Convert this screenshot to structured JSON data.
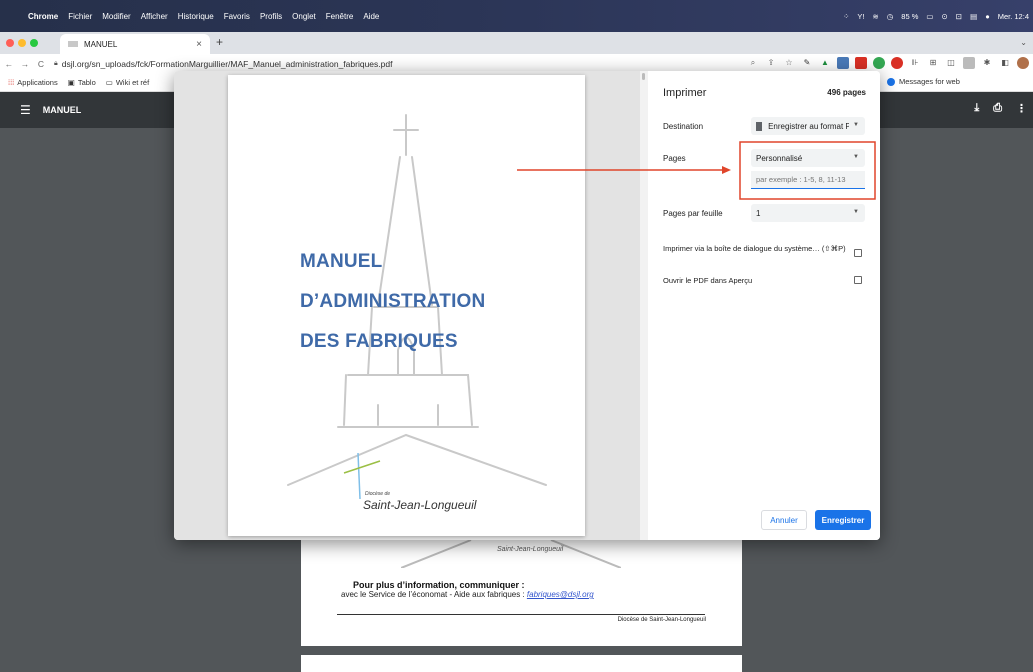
{
  "menubar": {
    "app": "Chrome",
    "items": [
      "Fichier",
      "Modifier",
      "Afficher",
      "Historique",
      "Favoris",
      "Profils",
      "Onglet",
      "Fenêtre",
      "Aide"
    ],
    "battery": "85 %",
    "clock": "Mer. 12:4"
  },
  "tab": {
    "title": "MANUEL"
  },
  "address": {
    "url": "dsjl.org/sn_uploads/fck/FormationMarguillier/MAF_Manuel_administration_fabriques.pdf"
  },
  "bookmarks": {
    "items": [
      "Applications",
      "Tablo",
      "Wiki et réf"
    ],
    "right_item": "Messages for web"
  },
  "pdf_toolbar": {
    "title": "MANUEL"
  },
  "preview_page": {
    "title_lines": [
      "MANUEL",
      "D’ADMINISTRATION",
      "DES FABRIQUES"
    ],
    "diocese_small": "Diocèse de",
    "diocese_name": "Saint-Jean-Longueuil"
  },
  "background_page": {
    "diocese_name": "Saint-Jean-Longueuil",
    "info_heading": "Pour plus d’information, communiquer :",
    "info_text": "avec le Service de l’économat - Aide aux fabriques : ",
    "info_email": "fabriques@dsjl.org",
    "footer": "Diocèse de Saint-Jean-Longueuil"
  },
  "print_dialog": {
    "title": "Imprimer",
    "page_count": "496 pages",
    "destination_label": "Destination",
    "destination_value": "Enregistrer au format PDF",
    "pages_label": "Pages",
    "pages_value": "Personnalisé",
    "pages_placeholder": "par exemple : 1-5, 8, 11-13",
    "pages_per_sheet_label": "Pages par feuille",
    "pages_per_sheet_value": "1",
    "system_dialog_link": "Imprimer via la boîte de dialogue du système… (⇧⌘P)",
    "open_preview_link": "Ouvrir le PDF dans Aperçu",
    "cancel_label": "Annuler",
    "save_label": "Enregistrer"
  },
  "colors": {
    "accent": "#1a73e8",
    "annotation": "#e0452b",
    "title_blue": "#3f6aa8"
  }
}
